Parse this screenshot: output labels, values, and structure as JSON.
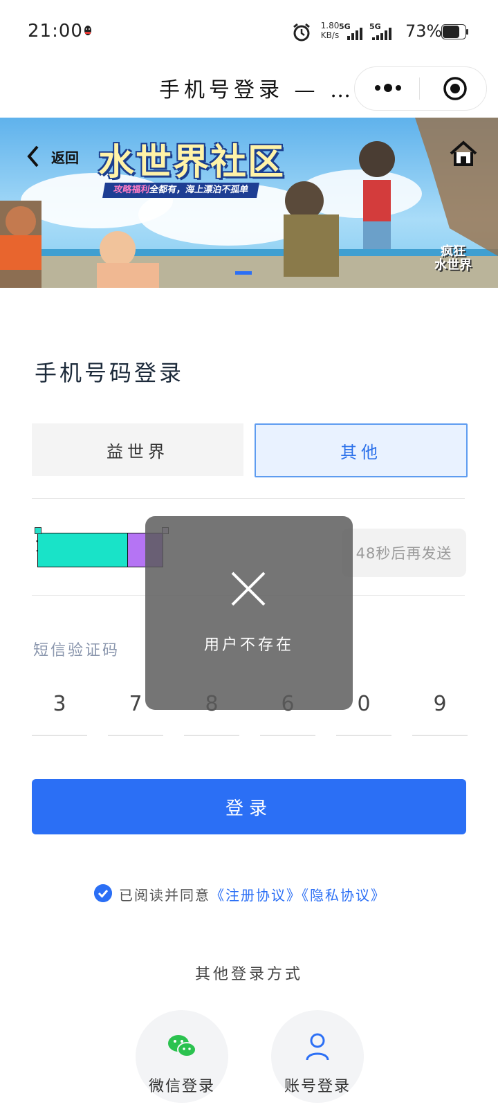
{
  "status_bar": {
    "time": "21:00",
    "net_speed_value": "1.80",
    "net_speed_unit": "KB/s",
    "sim1": "5G",
    "sim2": "5G",
    "battery": "73%"
  },
  "header": {
    "title": "手机号登录 — …",
    "more_icon": "more-dots-icon",
    "target_icon": "target-icon"
  },
  "banner": {
    "back_label": "返回",
    "title": "水世界社区",
    "subtitle_highlight": "攻略福利",
    "subtitle_rest": "全都有，海上漂泊不孤单",
    "logo_line1": "疯狂",
    "logo_line2": "水世界",
    "home_icon": "home-icon"
  },
  "page_heading": "手机号码登录",
  "tabs": [
    {
      "label": "益世界",
      "selected": false
    },
    {
      "label": "其他",
      "selected": true
    }
  ],
  "phone": {
    "first_digit": "1",
    "resend_label": "48秒后再发送"
  },
  "sms": {
    "label": "短信验证码",
    "digits": [
      "3",
      "7",
      "8",
      "6",
      "0",
      "9"
    ]
  },
  "login_button": "登录",
  "agreement": {
    "prefix": "已阅读并同意",
    "link1": "《注册协议》",
    "link2": "《隐私协议》",
    "checked": true
  },
  "other_methods": {
    "title": "其他登录方式",
    "wechat": "微信登录",
    "account": "账号登录"
  },
  "toast": {
    "message": "用户不存在",
    "icon": "close-icon"
  },
  "colors": {
    "primary": "#2b6ff5",
    "tab_selected_bg": "#e9f2ff",
    "tab_selected_border": "#5e9cf0",
    "wechat_green": "#2bc24f"
  }
}
